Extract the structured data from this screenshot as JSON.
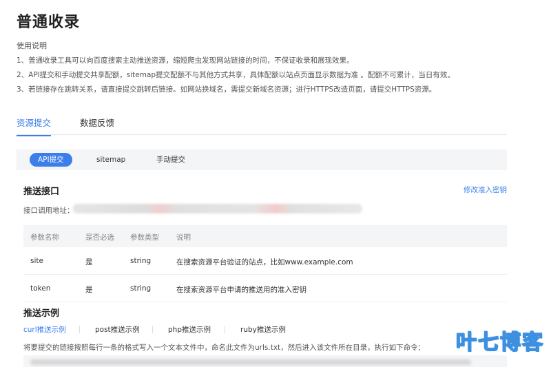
{
  "page": {
    "title": "普通收录",
    "usage_title": "使用说明",
    "notes": [
      "1、普通收录工具可以向百度搜索主动推送资源，缩短爬虫发现网站链接的时间，不保证收录和展现效果。",
      "2、API提交和手动提交共享配额，sitemap提交配额不与其他方式共享，具体配额以站点页面显示数据为准 。配额不可累计，当日有效。",
      "3、若链接存在跳转关系，请直接提交跳转后链接。如网站换域名，需提交新域名资源；进行HTTPS改造页面，请提交HTTPS资源。"
    ]
  },
  "main_tabs": [
    {
      "label": "资源提交",
      "active": true
    },
    {
      "label": "数据反馈",
      "active": false
    }
  ],
  "sub_tabs": [
    {
      "label": "API提交",
      "active": true
    },
    {
      "label": "sitemap",
      "active": false
    },
    {
      "label": "手动提交",
      "active": false
    }
  ],
  "push": {
    "title": "推送接口",
    "modify_link": "修改准入密钥",
    "api_label": "接口调用地址："
  },
  "params_table": {
    "headers": [
      "参数名称",
      "是否必选",
      "参数类型",
      "说明"
    ],
    "rows": [
      [
        "site",
        "是",
        "string",
        "在搜索资源平台验证的站点，比如www.example.com"
      ],
      [
        "token",
        "是",
        "string",
        "在搜索资源平台申请的推送用的准入密钥"
      ]
    ]
  },
  "example": {
    "title": "推送示例",
    "tabs": [
      {
        "label": "curl推送示例",
        "active": true
      },
      {
        "label": "post推送示例",
        "active": false
      },
      {
        "label": "php推送示例",
        "active": false
      },
      {
        "label": "ruby推送示例",
        "active": false
      }
    ],
    "description": "将要提交的链接按照每行一条的格式写入一个文本文件中，命名此文件为urls.txt，然后进入该文件所在目录，执行如下命令："
  },
  "watermark": "叶七博客",
  "colors": {
    "accent": "#3b7de9",
    "panel_bg": "#f4f5f7",
    "watermark_stroke": "#3d8fe0"
  }
}
